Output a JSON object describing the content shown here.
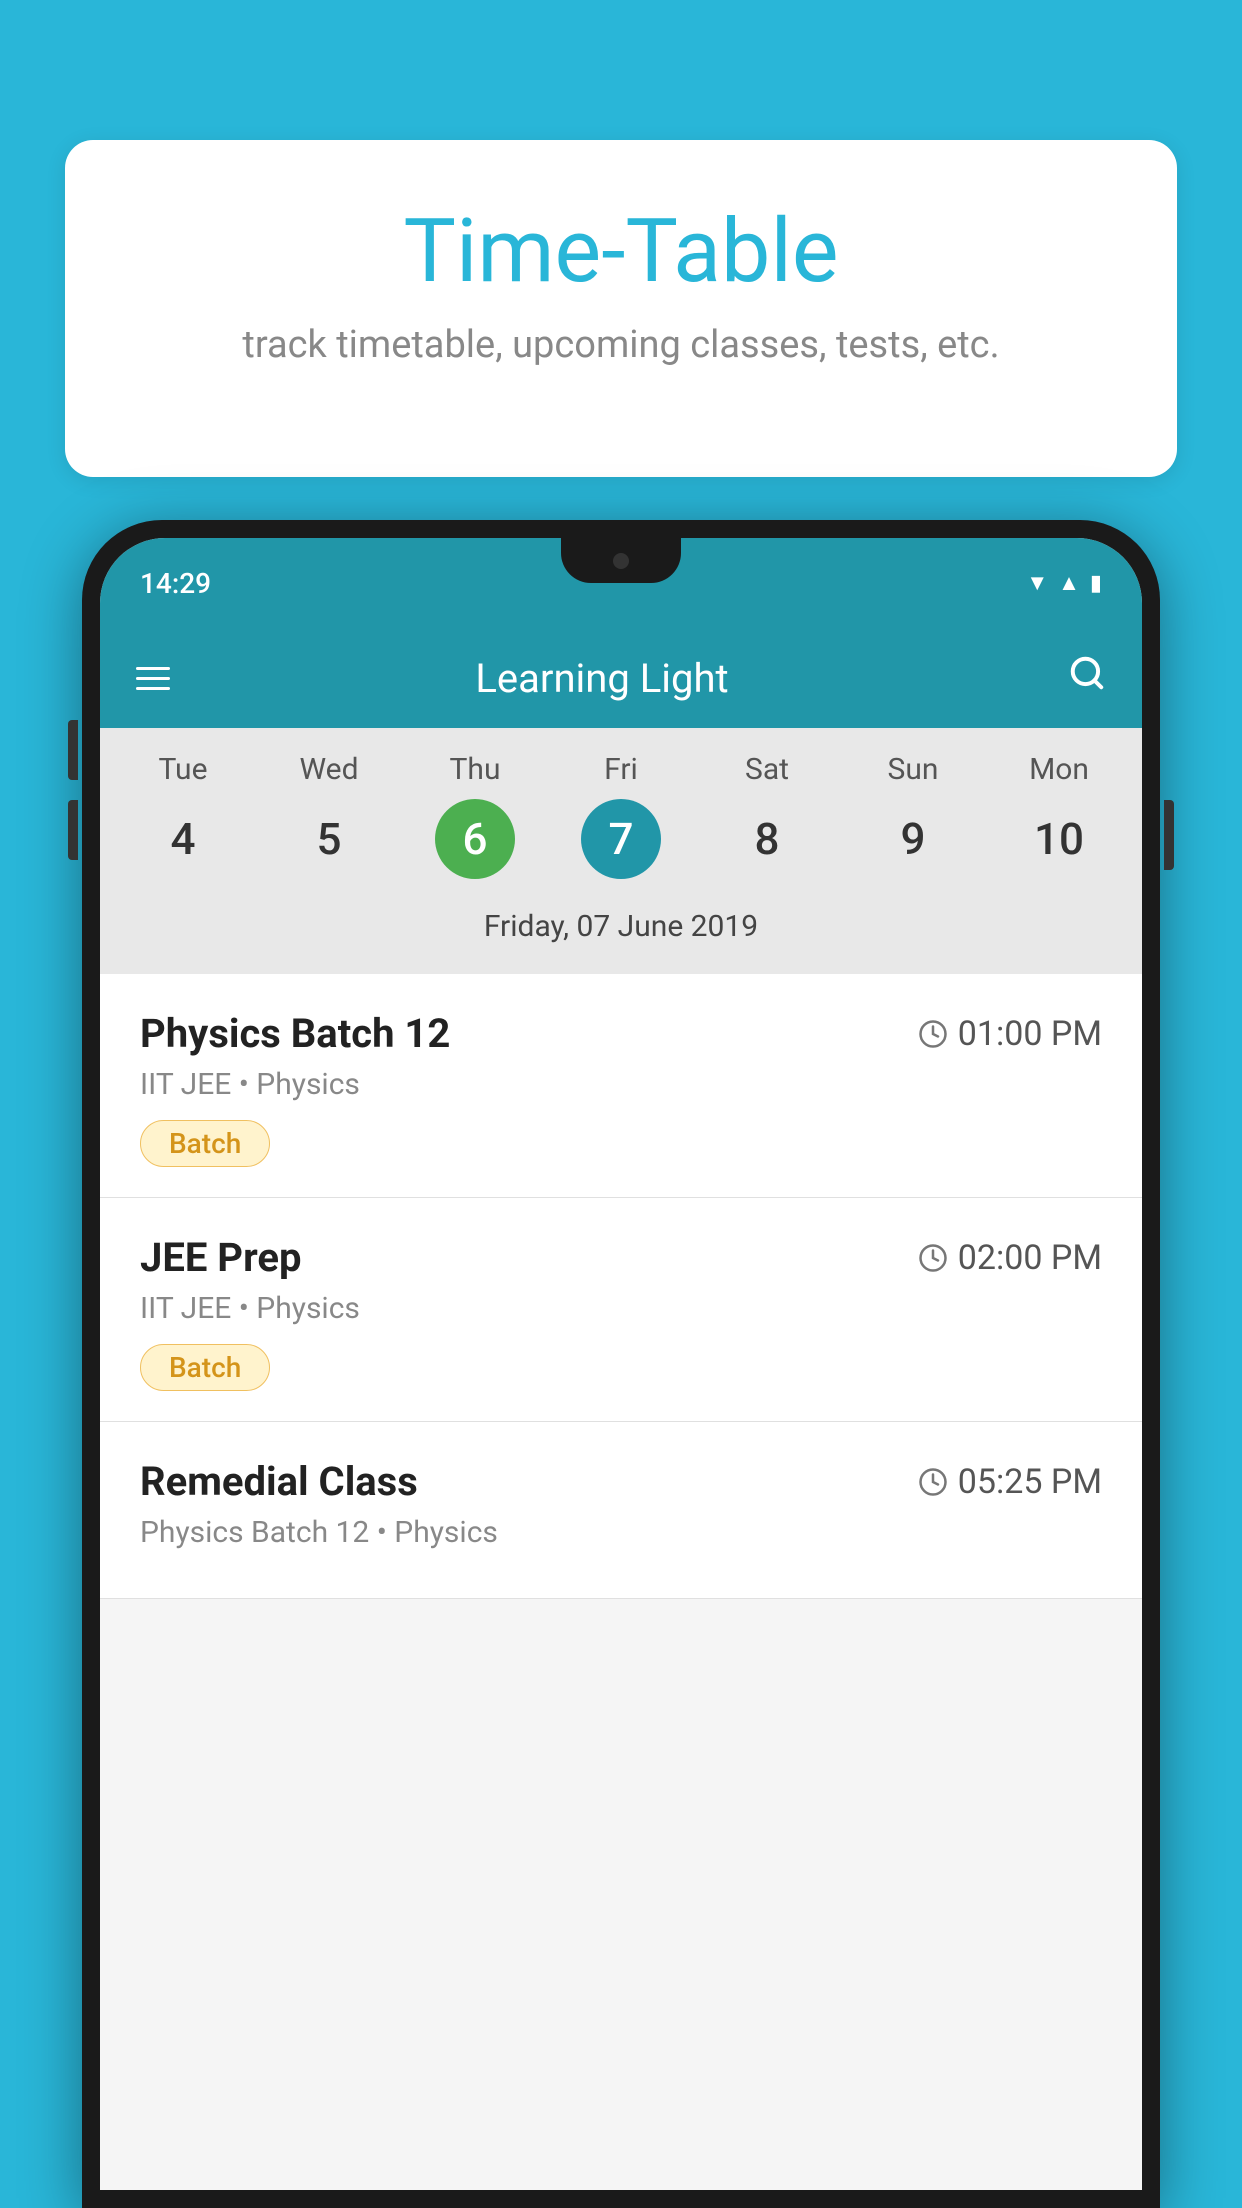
{
  "background_color": "#29b6d8",
  "bubble": {
    "title": "Time-Table",
    "subtitle": "track timetable, upcoming classes, tests, etc."
  },
  "phone": {
    "status_bar": {
      "time": "14:29"
    },
    "app_bar": {
      "title": "Learning Light"
    },
    "calendar": {
      "days": [
        {
          "name": "Tue",
          "number": "4",
          "state": "normal"
        },
        {
          "name": "Wed",
          "number": "5",
          "state": "normal"
        },
        {
          "name": "Thu",
          "number": "6",
          "state": "today"
        },
        {
          "name": "Fri",
          "number": "7",
          "state": "selected"
        },
        {
          "name": "Sat",
          "number": "8",
          "state": "normal"
        },
        {
          "name": "Sun",
          "number": "9",
          "state": "normal"
        },
        {
          "name": "Mon",
          "number": "10",
          "state": "normal"
        }
      ],
      "selected_date_label": "Friday, 07 June 2019"
    },
    "schedule": [
      {
        "class_name": "Physics Batch 12",
        "time": "01:00 PM",
        "details": "IIT JEE • Physics",
        "badge": "Batch"
      },
      {
        "class_name": "JEE Prep",
        "time": "02:00 PM",
        "details": "IIT JEE • Physics",
        "badge": "Batch"
      },
      {
        "class_name": "Remedial Class",
        "time": "05:25 PM",
        "details": "Physics Batch 12 • Physics",
        "badge": null
      }
    ]
  },
  "icons": {
    "hamburger": "☰",
    "search": "🔍",
    "clock": "🕐"
  }
}
